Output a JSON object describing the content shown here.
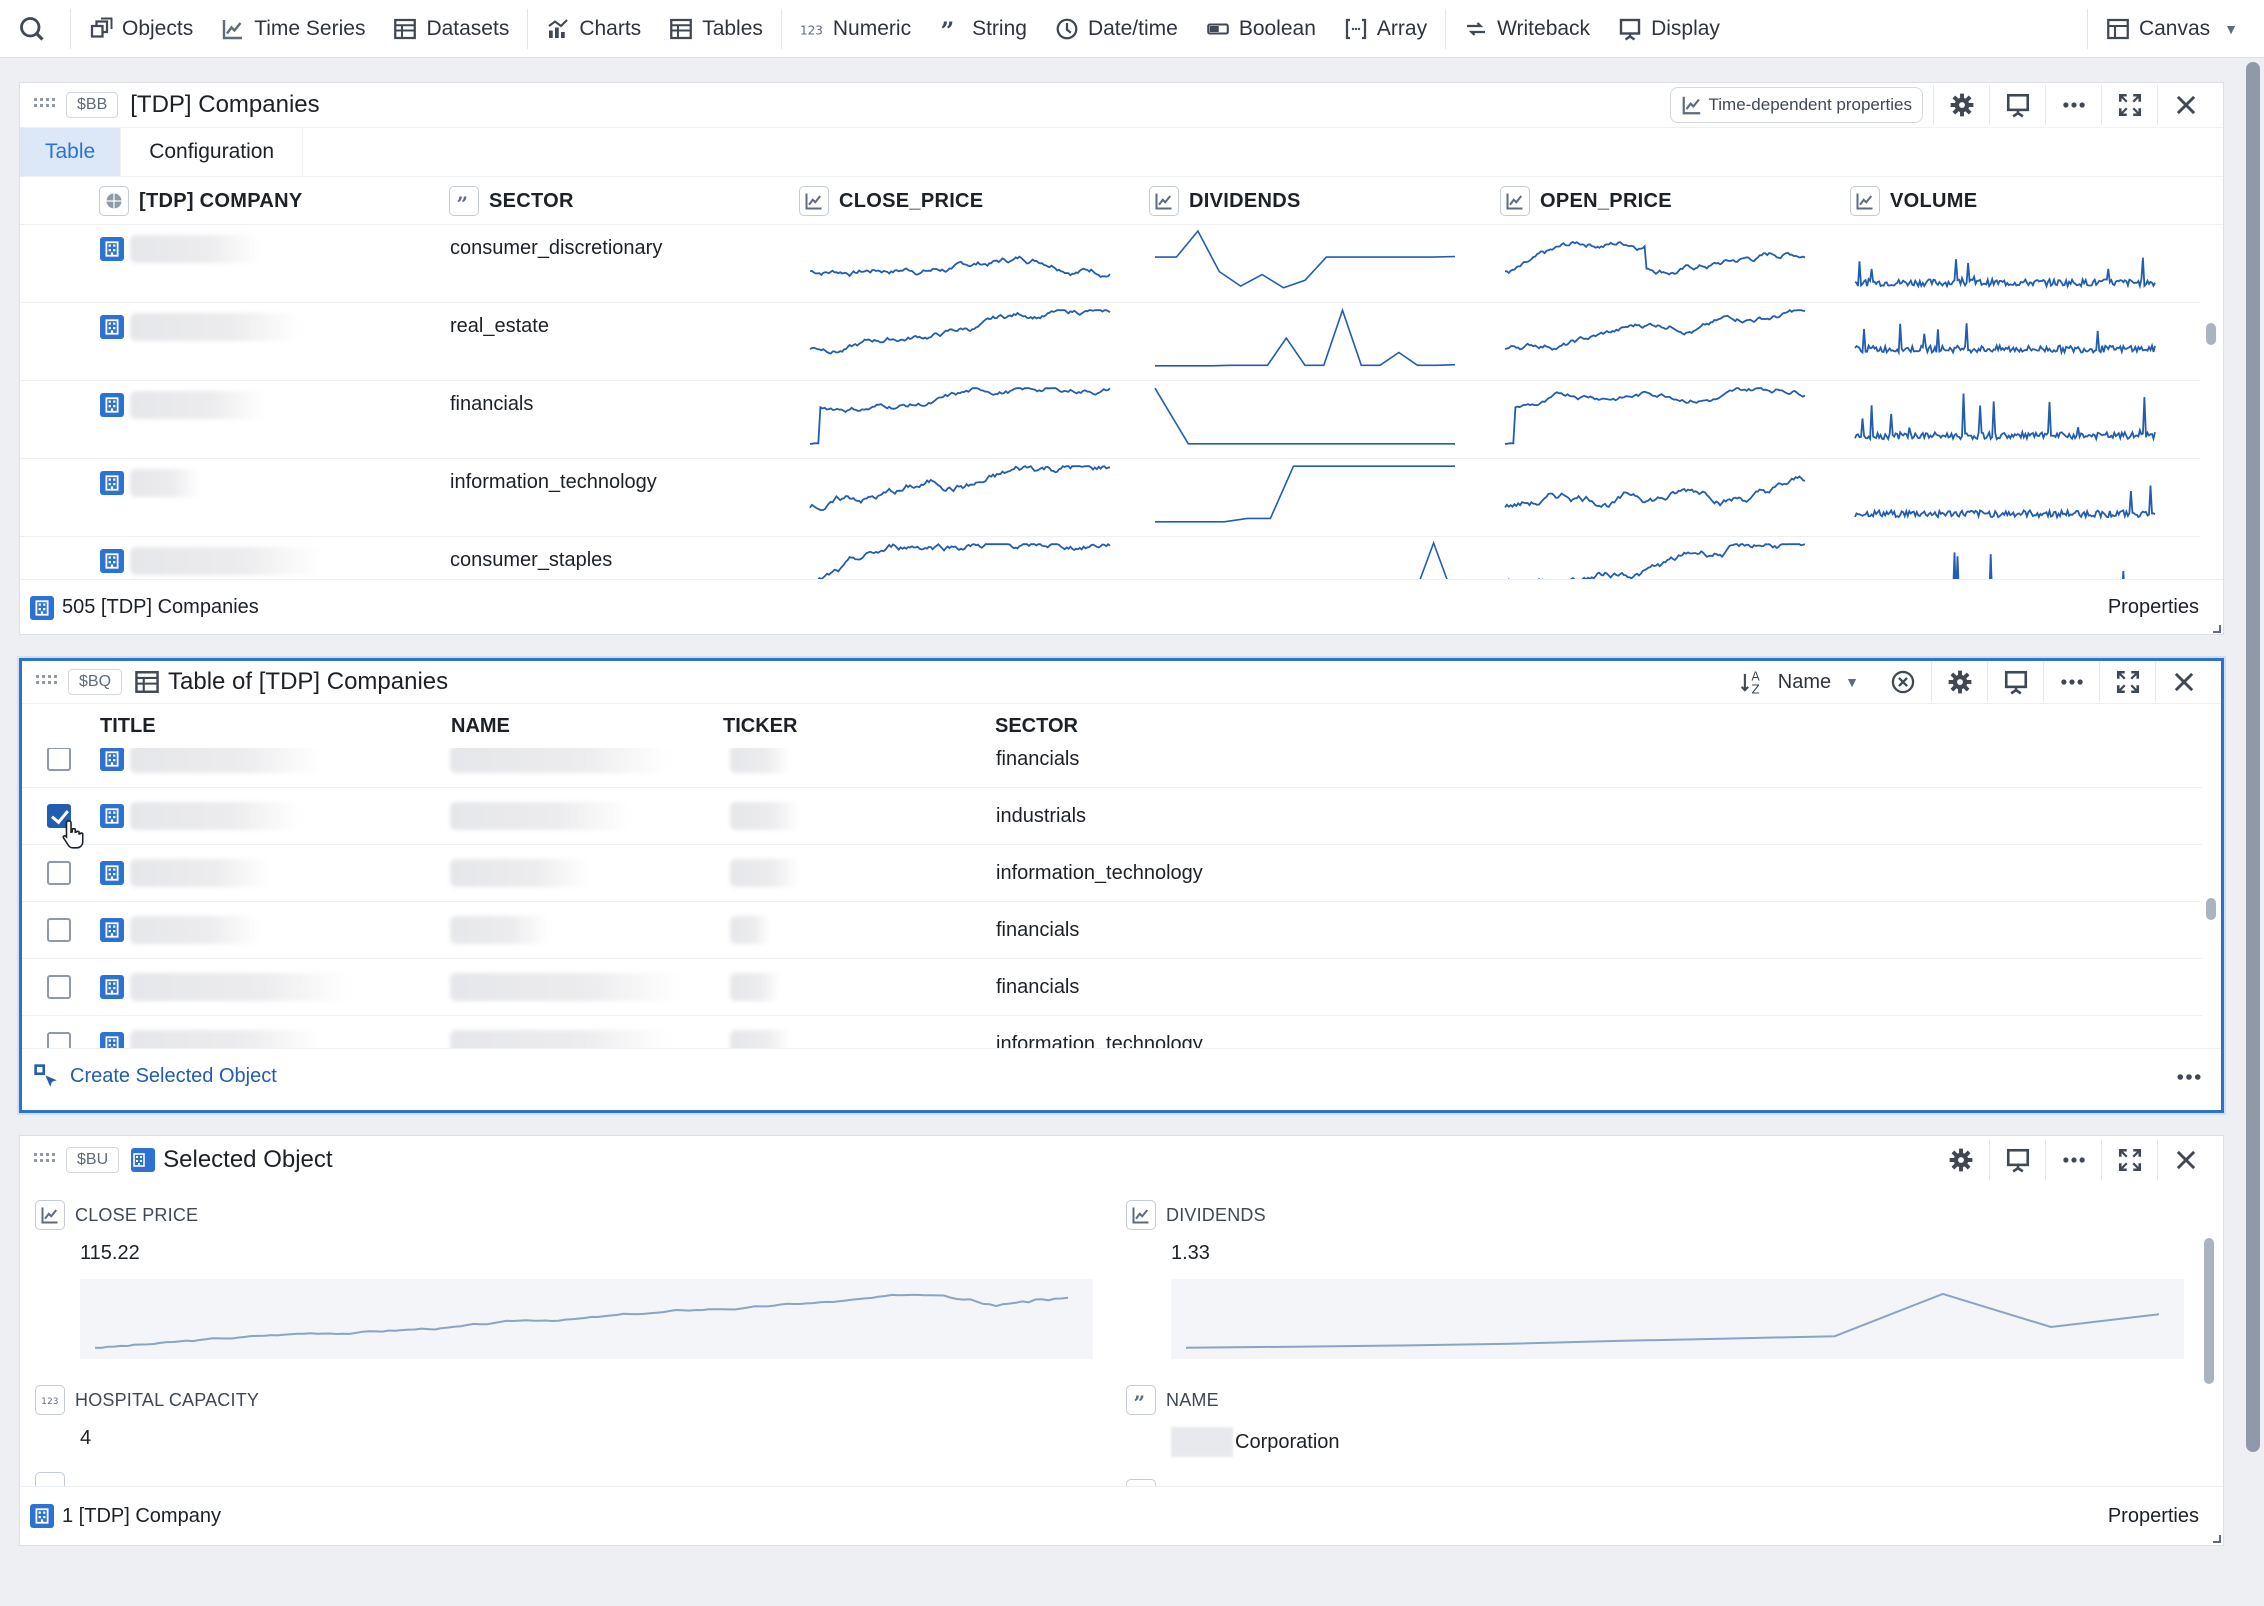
{
  "toolbar": {
    "items": [
      {
        "label": "Objects",
        "icon": "objects-icon"
      },
      {
        "label": "Time Series",
        "icon": "time-series-icon"
      },
      {
        "label": "Datasets",
        "icon": "dataset-icon"
      },
      {
        "label": "Charts",
        "icon": "charts-icon"
      },
      {
        "label": "Tables",
        "icon": "table-icon"
      },
      {
        "label": "Numeric",
        "icon": "numeric-icon"
      },
      {
        "label": "String",
        "icon": "string-icon"
      },
      {
        "label": "Date/time",
        "icon": "clock-icon"
      },
      {
        "label": "Boolean",
        "icon": "boolean-icon"
      },
      {
        "label": "Array",
        "icon": "array-icon"
      },
      {
        "label": "Writeback",
        "icon": "writeback-icon"
      },
      {
        "label": "Display",
        "icon": "display-icon"
      }
    ],
    "canvas_label": "Canvas"
  },
  "panel_companies": {
    "variable": "$BB",
    "title": "[TDP] Companies",
    "time_dependent_label": "Time-dependent properties",
    "tabs": [
      "Table",
      "Configuration"
    ],
    "selected_tab": "Table",
    "columns": [
      "[TDP] COMPANY",
      "SECTOR",
      "CLOSE_PRICE",
      "DIVIDENDS",
      "OPEN_PRICE",
      "VOLUME"
    ],
    "rows": [
      {
        "company": "(redacted)",
        "sector": "consumer_discretionary"
      },
      {
        "company": "(redacted)",
        "sector": "real_estate"
      },
      {
        "company": "(redacted)",
        "sector": "financials"
      },
      {
        "company": "(redacted)",
        "sector": "information_technology"
      },
      {
        "company": "(redacted)",
        "sector": "consumer_staples"
      }
    ],
    "footer_count": "505 [TDP] Companies",
    "footer_right": "Properties"
  },
  "panel_table": {
    "variable": "$BQ",
    "title": "Table of [TDP] Companies",
    "sort_label": "Name",
    "columns": [
      "TITLE",
      "NAME",
      "TICKER",
      "SECTOR"
    ],
    "rows": [
      {
        "sector": "financials",
        "checked": false
      },
      {
        "sector": "industrials",
        "checked": true
      },
      {
        "sector": "information_technology",
        "checked": false
      },
      {
        "sector": "financials",
        "checked": false
      },
      {
        "sector": "financials",
        "checked": false
      },
      {
        "sector": "information_technology",
        "checked": false
      }
    ],
    "create_label": "Create Selected Object"
  },
  "panel_object": {
    "variable": "$BU",
    "title": "Selected Object",
    "properties": [
      {
        "label": "CLOSE PRICE",
        "value": "115.22",
        "type": "time-series"
      },
      {
        "label": "DIVIDENDS",
        "value": "1.33",
        "type": "time-series"
      },
      {
        "label": "HOSPITAL CAPACITY",
        "value": "4",
        "type": "numeric"
      },
      {
        "label": "NAME",
        "value": "Corporation",
        "type": "string"
      }
    ],
    "footer_count": "1 [TDP] Company",
    "footer_right": "Properties"
  }
}
